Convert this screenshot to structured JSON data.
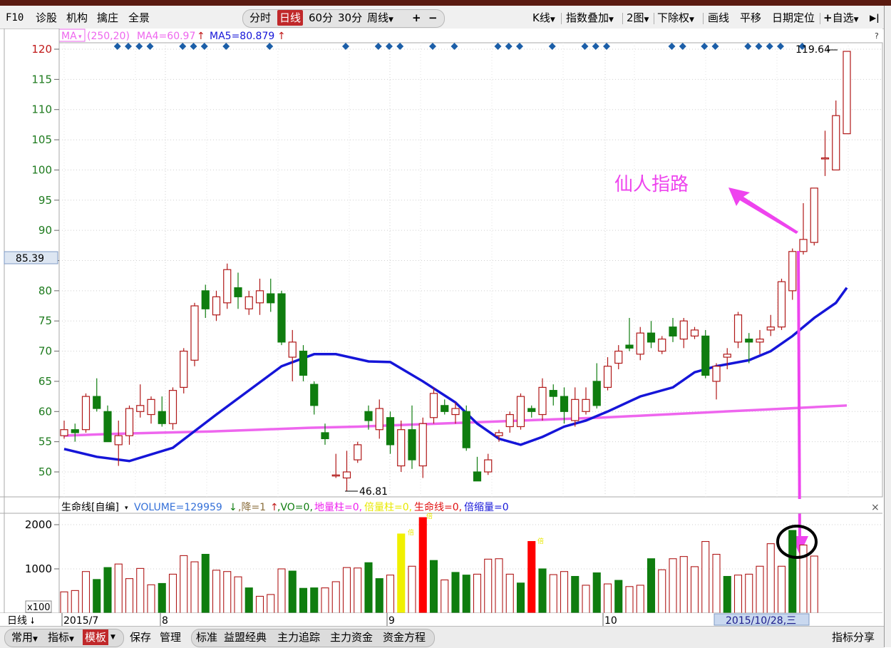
{
  "toolbar": {
    "f10": "F10",
    "zhengu": "诊股",
    "jigou": "机构",
    "qinzhuang": "擒庄",
    "quanjing": "全景",
    "fenshi": "分时",
    "rixian": "日线",
    "m60": "60分",
    "m30": "30分",
    "zhouxian": "周线",
    "plus": "+",
    "minus": "−",
    "kxian": "K线",
    "zhishudiejia": "指数叠加",
    "tu2": "2图",
    "xiachuquan": "下除权",
    "huaxian": "画线",
    "pingyi": "平移",
    "riqidingwei": "日期定位",
    "zixuan": "自选",
    "next": "▶|"
  },
  "ma_legend": {
    "indicator": "MA",
    "params": "(250,20)",
    "ma4": "MA4=60.97",
    "ma5": "MA5=80.879",
    "arrow": "↑"
  },
  "price_label": "85.39",
  "high_label": "119.64",
  "low_label": "46.81",
  "annotation_text": "仙人指路",
  "volume_legend": {
    "name": "生命线[自编]",
    "volume": "VOLUME=129959",
    "down": "↓",
    "jiang": ",降=1",
    "up": "↑",
    "vo": ",VO=0,",
    "dlz": "地量柱=0,",
    "blz": "倍量柱=0,",
    "smx": "生命线=0,",
    "bsl": "倍缩量=0"
  },
  "volume_unit": "x100",
  "period_label": "日线",
  "date_cursor": "2015/10/28,三",
  "bottom_bar": {
    "changyong": "常用",
    "zhibiao": "指标",
    "muban": "模板",
    "baocun": "保存",
    "guanli": "管理",
    "biaozhun": "标准",
    "yimengjingdian": "益盟经典",
    "zhulizhuizong": "主力追踪",
    "zhulizijin": "主力资金",
    "zijinfangcheng": "资金方程",
    "zhibiaofenxiang": "指标分享"
  },
  "colors": {
    "up": "#b01818",
    "down": "#0f7d0f",
    "ma_long": "#ee66ee",
    "ma_short": "#1515d8",
    "annotation": "#ee44ee",
    "axis_text": "#1d7a1d",
    "diamond": "#1b5ea8"
  },
  "chart_data": {
    "type": "candlestick",
    "y_ticks": [
      50,
      55,
      60,
      65,
      70,
      75,
      80,
      85,
      90,
      95,
      100,
      105,
      110,
      115,
      120
    ],
    "ylim": [
      45.8,
      121
    ],
    "x_tick_labels": [
      "2015/7",
      "8",
      "9",
      "10"
    ],
    "candles": [
      {
        "o": 56,
        "c": 57,
        "h": 58.5,
        "l": 55.5
      },
      {
        "o": 57,
        "c": 56.5,
        "h": 58,
        "l": 55
      },
      {
        "o": 57,
        "c": 62.5,
        "h": 63,
        "l": 56.5
      },
      {
        "o": 62.5,
        "c": 60.5,
        "h": 65.5,
        "l": 60
      },
      {
        "o": 60,
        "c": 55,
        "h": 61,
        "l": 55
      },
      {
        "o": 54.5,
        "c": 56,
        "h": 58.5,
        "l": 51
      },
      {
        "o": 56,
        "c": 60.5,
        "h": 61,
        "l": 54.5
      },
      {
        "o": 60,
        "c": 61,
        "h": 64.5,
        "l": 59
      },
      {
        "o": 59.5,
        "c": 62,
        "h": 62.5,
        "l": 58
      },
      {
        "o": 60,
        "c": 58,
        "h": 62.5,
        "l": 57.5
      },
      {
        "o": 58,
        "c": 63.5,
        "h": 64,
        "l": 57
      },
      {
        "o": 64,
        "c": 70,
        "h": 70.5,
        "l": 63
      },
      {
        "o": 68.5,
        "c": 77.5,
        "h": 78,
        "l": 67.5
      },
      {
        "o": 80,
        "c": 77,
        "h": 81,
        "l": 75.5
      },
      {
        "o": 76,
        "c": 79,
        "h": 80,
        "l": 75
      },
      {
        "o": 78,
        "c": 83.5,
        "h": 84.5,
        "l": 77
      },
      {
        "o": 80.5,
        "c": 79,
        "h": 83,
        "l": 77
      },
      {
        "o": 77,
        "c": 79,
        "h": 80,
        "l": 76
      },
      {
        "o": 78,
        "c": 80,
        "h": 82,
        "l": 76
      },
      {
        "o": 79.5,
        "c": 78,
        "h": 82,
        "l": 76.5
      },
      {
        "o": 79.5,
        "c": 71.5,
        "h": 80,
        "l": 71
      },
      {
        "o": 69,
        "c": 71.5,
        "h": 73.5,
        "l": 65
      },
      {
        "o": 70,
        "c": 66,
        "h": 71,
        "l": 65
      },
      {
        "o": 64.5,
        "c": 61,
        "h": 65,
        "l": 59.5
      },
      {
        "o": 56.5,
        "c": 55.5,
        "h": 58,
        "l": 54.5
      },
      {
        "o": 49.5,
        "c": 49.5,
        "h": 53,
        "l": 49
      },
      {
        "o": 49,
        "c": 50,
        "h": 53.5,
        "l": 46.8
      },
      {
        "o": 52,
        "c": 54.5,
        "h": 55,
        "l": 51.5
      },
      {
        "o": 60,
        "c": 58.5,
        "h": 61,
        "l": 57
      },
      {
        "o": 57,
        "c": 60.5,
        "h": 62,
        "l": 55.5
      },
      {
        "o": 59,
        "c": 54.5,
        "h": 60,
        "l": 53
      },
      {
        "o": 51,
        "c": 57,
        "h": 58.5,
        "l": 50
      },
      {
        "o": 57,
        "c": 52,
        "h": 61,
        "l": 50.5
      },
      {
        "o": 51,
        "c": 58,
        "h": 59,
        "l": 49
      },
      {
        "o": 59,
        "c": 63,
        "h": 64,
        "l": 58
      },
      {
        "o": 61,
        "c": 60,
        "h": 62,
        "l": 59.5
      },
      {
        "o": 59.5,
        "c": 60.5,
        "h": 61.5,
        "l": 58
      },
      {
        "o": 60,
        "c": 54,
        "h": 61,
        "l": 53.5
      },
      {
        "o": 50,
        "c": 48.5,
        "h": 52.5,
        "l": 48.5
      },
      {
        "o": 50,
        "c": 52,
        "h": 53,
        "l": 49.5
      },
      {
        "o": 56,
        "c": 56.5,
        "h": 57,
        "l": 55
      },
      {
        "o": 57.5,
        "c": 59.5,
        "h": 60,
        "l": 56.5
      },
      {
        "o": 57.5,
        "c": 62.5,
        "h": 63,
        "l": 57
      },
      {
        "o": 60.5,
        "c": 60,
        "h": 61,
        "l": 59
      },
      {
        "o": 59.5,
        "c": 64,
        "h": 65.5,
        "l": 58.5
      },
      {
        "o": 63.5,
        "c": 62.5,
        "h": 64.5,
        "l": 61
      },
      {
        "o": 62.5,
        "c": 60,
        "h": 64,
        "l": 58
      },
      {
        "o": 58.5,
        "c": 62,
        "h": 64,
        "l": 57.5
      },
      {
        "o": 60,
        "c": 62,
        "h": 64,
        "l": 59.5
      },
      {
        "o": 65,
        "c": 61,
        "h": 68,
        "l": 60.5
      },
      {
        "o": 64,
        "c": 67.5,
        "h": 69,
        "l": 63.5
      },
      {
        "o": 68,
        "c": 70,
        "h": 71,
        "l": 67
      },
      {
        "o": 71,
        "c": 70.5,
        "h": 75.5,
        "l": 70
      },
      {
        "o": 69.5,
        "c": 73,
        "h": 74,
        "l": 68.5
      },
      {
        "o": 73,
        "c": 71.5,
        "h": 75,
        "l": 70.5
      },
      {
        "o": 70,
        "c": 72,
        "h": 72.5,
        "l": 69.5
      },
      {
        "o": 74,
        "c": 72.5,
        "h": 75.5,
        "l": 71.5
      },
      {
        "o": 72,
        "c": 75,
        "h": 75.5,
        "l": 70.5
      },
      {
        "o": 72.5,
        "c": 73.5,
        "h": 74,
        "l": 72
      },
      {
        "o": 72.5,
        "c": 66,
        "h": 73.5,
        "l": 65.5
      },
      {
        "o": 65,
        "c": 67.5,
        "h": 68,
        "l": 62
      },
      {
        "o": 69,
        "c": 69.5,
        "h": 70.5,
        "l": 67
      },
      {
        "o": 71.5,
        "c": 76,
        "h": 76.5,
        "l": 70.5
      },
      {
        "o": 72,
        "c": 71.5,
        "h": 73,
        "l": 68
      },
      {
        "o": 71.5,
        "c": 72,
        "h": 73.5,
        "l": 69.5
      },
      {
        "o": 73.5,
        "c": 74,
        "h": 76,
        "l": 72.5
      },
      {
        "o": 74,
        "c": 81.5,
        "h": 82,
        "l": 73.5
      },
      {
        "o": 80,
        "c": 86.5,
        "h": 87,
        "l": 78.5
      },
      {
        "o": 86.5,
        "c": 88.5,
        "h": 94.5,
        "l": 86
      },
      {
        "o": 88,
        "c": 97,
        "h": 97,
        "l": 87.5
      },
      {
        "o": 102,
        "c": 102,
        "h": 106.5,
        "l": 99
      },
      {
        "o": 100,
        "c": 109,
        "h": 111.5,
        "l": 100
      },
      {
        "o": 106,
        "c": 119.64,
        "h": 119.64,
        "l": 106
      }
    ],
    "ma250": [
      56,
      56.3,
      56.5,
      56.7,
      57,
      57.3,
      57.5,
      57.8,
      58.1,
      58.4,
      58.7,
      59,
      59.4,
      59.8,
      60.2,
      60.6,
      61
    ],
    "ma20_points": [
      [
        0,
        53.8
      ],
      [
        3,
        52.5
      ],
      [
        6,
        51.8
      ],
      [
        10,
        54
      ],
      [
        14,
        59.5
      ],
      [
        17,
        63.5
      ],
      [
        20,
        67.5
      ],
      [
        23,
        69.5
      ],
      [
        25,
        69.5
      ],
      [
        28,
        68.3
      ],
      [
        30,
        68.2
      ],
      [
        33,
        65
      ],
      [
        36,
        61.5
      ],
      [
        38,
        58
      ],
      [
        40,
        55.5
      ],
      [
        42,
        54.5
      ],
      [
        44,
        55.8
      ],
      [
        46,
        57.5
      ],
      [
        48,
        58.5
      ],
      [
        50,
        60
      ],
      [
        53,
        62.5
      ],
      [
        56,
        64
      ],
      [
        58,
        66.5
      ],
      [
        60,
        67.5
      ],
      [
        63,
        68.5
      ],
      [
        65,
        70
      ],
      [
        67,
        72.5
      ],
      [
        69,
        75.5
      ],
      [
        71,
        78
      ],
      [
        72,
        80.5
      ]
    ],
    "volume_ticks": [
      1000,
      2000
    ],
    "volume_ylim": [
      0,
      2200
    ],
    "volumes": [
      480,
      510,
      940,
      760,
      1030,
      1110,
      780,
      1010,
      640,
      670,
      880,
      1300,
      1160,
      1330,
      970,
      940,
      820,
      570,
      380,
      420,
      1000,
      950,
      560,
      570,
      570,
      710,
      1030,
      1020,
      1140,
      780,
      860,
      1790,
      1060,
      2160,
      1190,
      750,
      920,
      860,
      880,
      1220,
      1230,
      880,
      680,
      1620,
      1000,
      870,
      940,
      830,
      630,
      910,
      660,
      740,
      600,
      630,
      1230,
      980,
      1230,
      1280,
      1050,
      1620,
      1330,
      830,
      860,
      880,
      1060,
      1570,
      1060,
      1870,
      1540,
      1290
    ],
    "volume_colors": [
      "up",
      "up",
      "up",
      "down",
      "down",
      "up",
      "up",
      "up",
      "up",
      "down",
      "up",
      "up",
      "up",
      "down",
      "up",
      "up",
      "up",
      "down",
      "up",
      "up",
      "up",
      "down",
      "down",
      "down",
      "up",
      "up",
      "up",
      "up",
      "down",
      "down",
      "up",
      "yellow",
      "up",
      "red",
      "down",
      "up",
      "down",
      "down",
      "up",
      "up",
      "up",
      "up",
      "down",
      "red",
      "down",
      "up",
      "up",
      "down",
      "up",
      "down",
      "up",
      "down",
      "up",
      "up",
      "down",
      "up",
      "up",
      "up",
      "up",
      "up",
      "up",
      "down",
      "up",
      "up",
      "up",
      "up",
      "up",
      "down",
      "up",
      "up"
    ],
    "diamonds": [
      3,
      4,
      5,
      6,
      9,
      10,
      11,
      13,
      17,
      24,
      27,
      28,
      29,
      32,
      34,
      38,
      39,
      40,
      43,
      46,
      47,
      48,
      54,
      55,
      57,
      58,
      61,
      62,
      63,
      64,
      66
    ]
  }
}
